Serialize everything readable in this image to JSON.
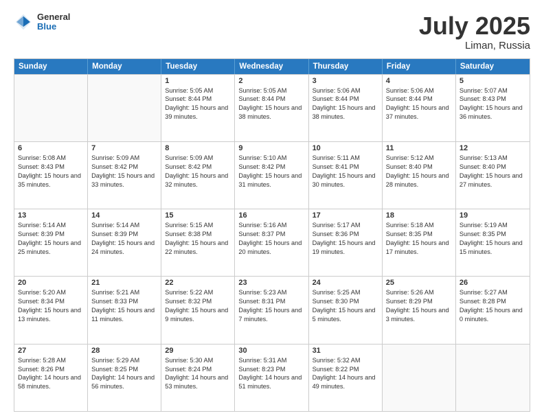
{
  "header": {
    "logo_general": "General",
    "logo_blue": "Blue",
    "month_title": "July 2025",
    "location": "Liman, Russia"
  },
  "days_of_week": [
    "Sunday",
    "Monday",
    "Tuesday",
    "Wednesday",
    "Thursday",
    "Friday",
    "Saturday"
  ],
  "weeks": [
    [
      {
        "day": "",
        "text": ""
      },
      {
        "day": "",
        "text": ""
      },
      {
        "day": "1",
        "text": "Sunrise: 5:05 AM\nSunset: 8:44 PM\nDaylight: 15 hours and 39 minutes."
      },
      {
        "day": "2",
        "text": "Sunrise: 5:05 AM\nSunset: 8:44 PM\nDaylight: 15 hours and 38 minutes."
      },
      {
        "day": "3",
        "text": "Sunrise: 5:06 AM\nSunset: 8:44 PM\nDaylight: 15 hours and 38 minutes."
      },
      {
        "day": "4",
        "text": "Sunrise: 5:06 AM\nSunset: 8:44 PM\nDaylight: 15 hours and 37 minutes."
      },
      {
        "day": "5",
        "text": "Sunrise: 5:07 AM\nSunset: 8:43 PM\nDaylight: 15 hours and 36 minutes."
      }
    ],
    [
      {
        "day": "6",
        "text": "Sunrise: 5:08 AM\nSunset: 8:43 PM\nDaylight: 15 hours and 35 minutes."
      },
      {
        "day": "7",
        "text": "Sunrise: 5:09 AM\nSunset: 8:42 PM\nDaylight: 15 hours and 33 minutes."
      },
      {
        "day": "8",
        "text": "Sunrise: 5:09 AM\nSunset: 8:42 PM\nDaylight: 15 hours and 32 minutes."
      },
      {
        "day": "9",
        "text": "Sunrise: 5:10 AM\nSunset: 8:42 PM\nDaylight: 15 hours and 31 minutes."
      },
      {
        "day": "10",
        "text": "Sunrise: 5:11 AM\nSunset: 8:41 PM\nDaylight: 15 hours and 30 minutes."
      },
      {
        "day": "11",
        "text": "Sunrise: 5:12 AM\nSunset: 8:40 PM\nDaylight: 15 hours and 28 minutes."
      },
      {
        "day": "12",
        "text": "Sunrise: 5:13 AM\nSunset: 8:40 PM\nDaylight: 15 hours and 27 minutes."
      }
    ],
    [
      {
        "day": "13",
        "text": "Sunrise: 5:14 AM\nSunset: 8:39 PM\nDaylight: 15 hours and 25 minutes."
      },
      {
        "day": "14",
        "text": "Sunrise: 5:14 AM\nSunset: 8:39 PM\nDaylight: 15 hours and 24 minutes."
      },
      {
        "day": "15",
        "text": "Sunrise: 5:15 AM\nSunset: 8:38 PM\nDaylight: 15 hours and 22 minutes."
      },
      {
        "day": "16",
        "text": "Sunrise: 5:16 AM\nSunset: 8:37 PM\nDaylight: 15 hours and 20 minutes."
      },
      {
        "day": "17",
        "text": "Sunrise: 5:17 AM\nSunset: 8:36 PM\nDaylight: 15 hours and 19 minutes."
      },
      {
        "day": "18",
        "text": "Sunrise: 5:18 AM\nSunset: 8:35 PM\nDaylight: 15 hours and 17 minutes."
      },
      {
        "day": "19",
        "text": "Sunrise: 5:19 AM\nSunset: 8:35 PM\nDaylight: 15 hours and 15 minutes."
      }
    ],
    [
      {
        "day": "20",
        "text": "Sunrise: 5:20 AM\nSunset: 8:34 PM\nDaylight: 15 hours and 13 minutes."
      },
      {
        "day": "21",
        "text": "Sunrise: 5:21 AM\nSunset: 8:33 PM\nDaylight: 15 hours and 11 minutes."
      },
      {
        "day": "22",
        "text": "Sunrise: 5:22 AM\nSunset: 8:32 PM\nDaylight: 15 hours and 9 minutes."
      },
      {
        "day": "23",
        "text": "Sunrise: 5:23 AM\nSunset: 8:31 PM\nDaylight: 15 hours and 7 minutes."
      },
      {
        "day": "24",
        "text": "Sunrise: 5:25 AM\nSunset: 8:30 PM\nDaylight: 15 hours and 5 minutes."
      },
      {
        "day": "25",
        "text": "Sunrise: 5:26 AM\nSunset: 8:29 PM\nDaylight: 15 hours and 3 minutes."
      },
      {
        "day": "26",
        "text": "Sunrise: 5:27 AM\nSunset: 8:28 PM\nDaylight: 15 hours and 0 minutes."
      }
    ],
    [
      {
        "day": "27",
        "text": "Sunrise: 5:28 AM\nSunset: 8:26 PM\nDaylight: 14 hours and 58 minutes."
      },
      {
        "day": "28",
        "text": "Sunrise: 5:29 AM\nSunset: 8:25 PM\nDaylight: 14 hours and 56 minutes."
      },
      {
        "day": "29",
        "text": "Sunrise: 5:30 AM\nSunset: 8:24 PM\nDaylight: 14 hours and 53 minutes."
      },
      {
        "day": "30",
        "text": "Sunrise: 5:31 AM\nSunset: 8:23 PM\nDaylight: 14 hours and 51 minutes."
      },
      {
        "day": "31",
        "text": "Sunrise: 5:32 AM\nSunset: 8:22 PM\nDaylight: 14 hours and 49 minutes."
      },
      {
        "day": "",
        "text": ""
      },
      {
        "day": "",
        "text": ""
      }
    ]
  ]
}
